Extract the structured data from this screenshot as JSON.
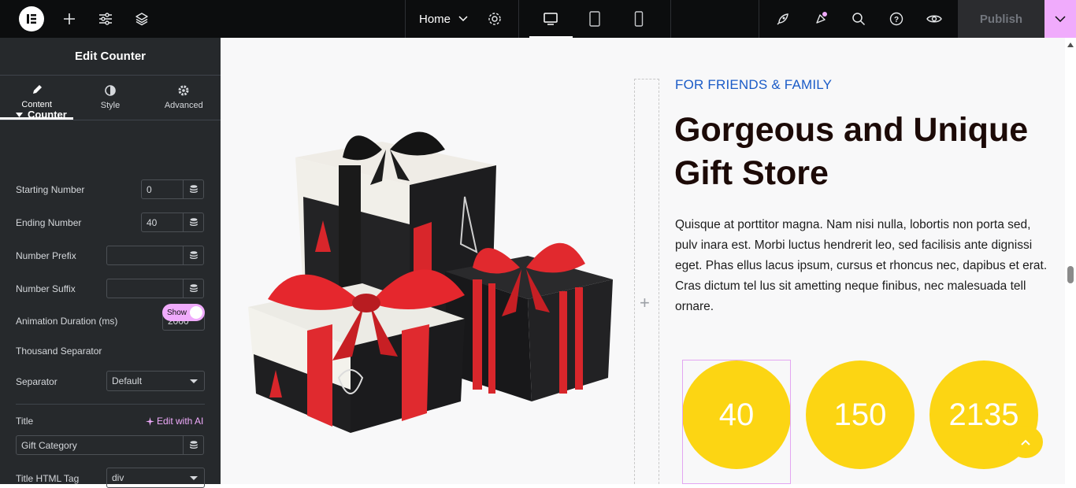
{
  "topbar": {
    "page_name": "Home",
    "publish_label": "Publish",
    "icons": [
      "elementor-logo-icon",
      "add-icon",
      "settings-sliders-icon",
      "layers-icon",
      "chevron-down-icon",
      "gear-icon",
      "desktop-icon",
      "tablet-icon",
      "mobile-icon",
      "rocket-icon",
      "notification-icon",
      "search-icon",
      "help-icon",
      "eye-icon"
    ]
  },
  "panel": {
    "title": "Edit Counter",
    "tabs": [
      {
        "label": "Content",
        "icon": "pencil-icon"
      },
      {
        "label": "Style",
        "icon": "half-circle-icon"
      },
      {
        "label": "Advanced",
        "icon": "gear-icon"
      }
    ],
    "section": "Counter",
    "starting_number_label": "Starting Number",
    "starting_number_value": "0",
    "ending_number_label": "Ending Number",
    "ending_number_value": "40",
    "prefix_label": "Number Prefix",
    "suffix_label": "Number Suffix",
    "duration_label": "Animation Duration (ms)",
    "duration_value": "2000",
    "thousand_sep_label": "Thousand Separator",
    "thousand_sep_value": "Show",
    "separator_label": "Separator",
    "separator_value": "Default",
    "title_label": "Title",
    "edit_ai_label": "Edit with AI",
    "title_value": "Gift Category",
    "title_tag_label": "Title HTML Tag",
    "title_tag_value": "div"
  },
  "content": {
    "kicker": "FOR FRIENDS & FAMILY",
    "headline": "Gorgeous and Unique Gift Store",
    "paragraph": "Quisque at porttitor magna. Nam nisi nulla, lobortis non porta sed, pulv inara est. Morbi luctus hendrerit leo, sed facilisis ante dignissi eget. Phas ellus lacus ipsum, cursus et rhoncus nec, dapibus et erat. Cras dictum tel lus sit ametting neque finibus, nec malesuada tell ornare.",
    "counters": [
      "40",
      "150",
      "2135"
    ]
  },
  "colors": {
    "accent_pink": "#f0abfc",
    "counter_yellow": "#fcd513",
    "kicker_blue": "#1a5bc7",
    "headline_dark": "#1c0a07"
  }
}
